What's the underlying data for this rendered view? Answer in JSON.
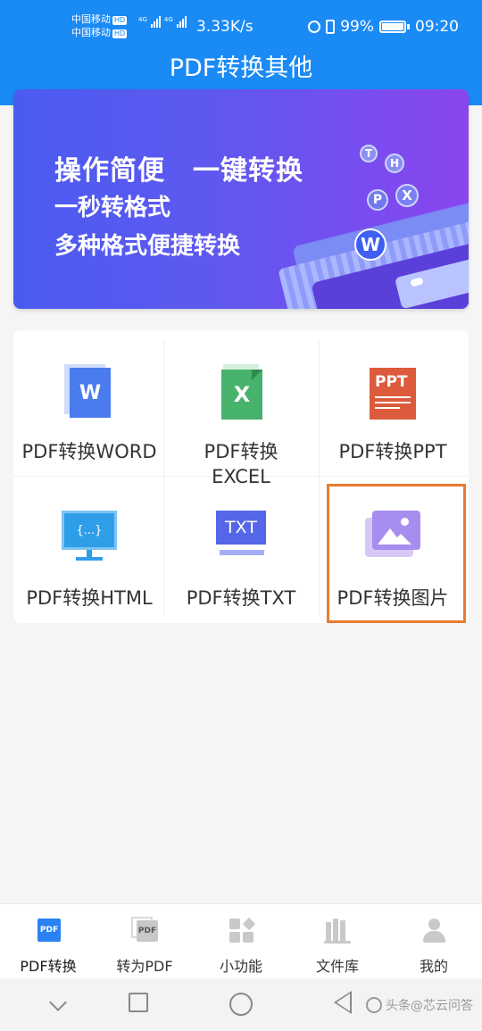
{
  "status_bar": {
    "carrier1": "中国移动",
    "carrier2": "中国移动",
    "hd_badge": "HD",
    "net1": "4G",
    "net2": "4G",
    "speed": "3.33K/s",
    "battery": "99%",
    "time": "09:20"
  },
  "header": {
    "title": "PDF转换其他"
  },
  "banner": {
    "line1": "操作简便　一键转换",
    "line2": "一秒转格式",
    "line3": "多种格式便捷转换",
    "coin_t": "T",
    "coin_h": "H",
    "coin_p": "P",
    "coin_x": "X",
    "coin_w": "W"
  },
  "grid": {
    "items": [
      {
        "label": "PDF转换WORD",
        "icon": "word-doc-icon",
        "glyph": "W"
      },
      {
        "label": "PDF转换EXCEL",
        "icon": "excel-doc-icon",
        "glyph": "X"
      },
      {
        "label": "PDF转换PPT",
        "icon": "ppt-doc-icon",
        "glyph": "PPT"
      },
      {
        "label": "PDF转换HTML",
        "icon": "html-monitor-icon",
        "glyph": "{...}"
      },
      {
        "label": "PDF转换TXT",
        "icon": "txt-doc-icon",
        "glyph": "TXT"
      },
      {
        "label": "PDF转换图片",
        "icon": "image-icon",
        "glyph": ""
      }
    ],
    "highlight_color": "#e87d2d"
  },
  "tabbar": {
    "tabs": [
      {
        "label": "PDF转换",
        "icon": "pdf-convert-icon",
        "glyph": "PDF",
        "active": true
      },
      {
        "label": "转为PDF",
        "icon": "to-pdf-icon",
        "glyph": "PDF",
        "active": false
      },
      {
        "label": "小功能",
        "icon": "grid-apps-icon",
        "active": false
      },
      {
        "label": "文件库",
        "icon": "library-icon",
        "active": false
      },
      {
        "label": "我的",
        "icon": "user-icon",
        "active": false
      }
    ]
  },
  "watermark": {
    "text": "头条@芯云问答"
  },
  "colors": {
    "primary": "#1a8af5",
    "banner_start": "#4a5bf0",
    "banner_end": "#8a45ee"
  }
}
